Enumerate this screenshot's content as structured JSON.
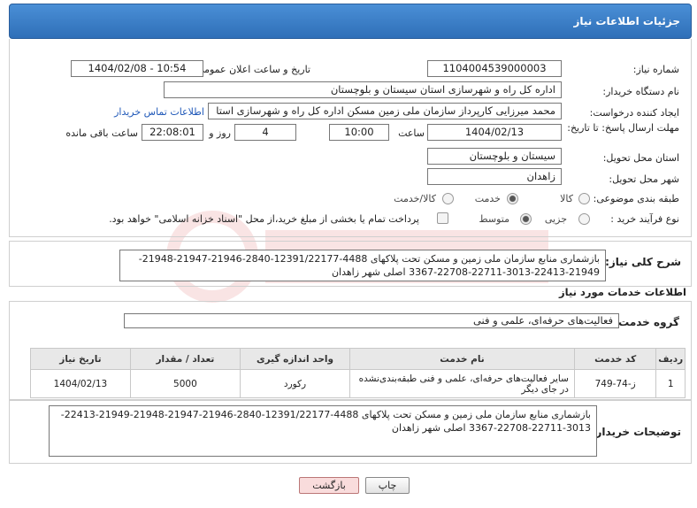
{
  "header": {
    "title": "جزئیات اطلاعات نیاز"
  },
  "fields": {
    "need_number_label": "شماره نیاز:",
    "need_number": "1104004539000003",
    "announce_label": "تاریخ و ساعت اعلان عمومی:",
    "announce_value": "1404/02/08 - 10:54",
    "buyer_org_label": "نام دستگاه خریدار:",
    "buyer_org": "اداره کل راه و شهرسازی استان سیستان و بلوچستان",
    "creator_label": "ایجاد کننده درخواست:",
    "creator": "محمد میرزایی کارپرداز سازمان ملی زمین مسکن اداره کل راه و شهرسازی استا",
    "contact_link": "اطلاعات تماس خریدار",
    "deadline_label": "مهلت ارسال پاسخ: تا تاریخ:",
    "deadline_date": "1404/02/13",
    "time_label": "ساعت",
    "deadline_time": "10:00",
    "days_value": "4",
    "days_label": "روز و",
    "remaining_time": "22:08:01",
    "remaining_label": "ساعت باقی مانده",
    "province_label": "استان محل تحویل:",
    "province": "سیستان و بلوچستان",
    "city_label": "شهر محل تحویل:",
    "city": "زاهدان",
    "category_label": "طبقه بندی موضوعی:",
    "category_options": [
      "کالا",
      "خدمت",
      "کالا/خدمت"
    ],
    "category_selected": "خدمت",
    "process_label": "نوع فرآیند خرید :",
    "process_options": [
      "جزیی",
      "متوسط"
    ],
    "process_selected": "متوسط",
    "payment_note": "پرداخت تمام یا بخشی از مبلغ خرید،از محل \"اسناد خزانه اسلامی\" خواهد بود."
  },
  "summary": {
    "label": "شرح کلی نیاز:",
    "text": "بازشماری منابع سازمان ملی زمین و مسکن تحت پلاکهای 4488-12391/22177-2840-21946-21947-21948-21949-22413-3013-22711-22708-3367 اصلی شهر زاهدان"
  },
  "services": {
    "section_title": "اطلاعات خدمات مورد نیاز",
    "group_label": "گروه خدمت:",
    "group_value": "فعالیت‌های حرفه‌ای، علمی و فنی",
    "columns": [
      "ردیف",
      "کد خدمت",
      "نام خدمت",
      "واحد اندازه گیری",
      "تعداد / مقدار",
      "تاریخ نیاز"
    ],
    "rows": [
      {
        "index": "1",
        "code": "ز-74-749",
        "name": "سایر فعالیت‌های حرفه‌ای، علمی و فنی طبقه‌بندی‌نشده در جای دیگر",
        "unit": "رکورد",
        "qty": "5000",
        "date": "1404/02/13"
      }
    ]
  },
  "buyer_notes": {
    "label": "توضیحات خریدار:",
    "text": "بازشماری منابع سازمان ملی زمین و مسکن تحت پلاکهای 4488-12391/22177-2840-21946-21947-21948-21949-22413-3013-22711-22708-3367 اصلی شهر زاهدان"
  },
  "buttons": {
    "print": "چاپ",
    "back": "بازگشت"
  }
}
